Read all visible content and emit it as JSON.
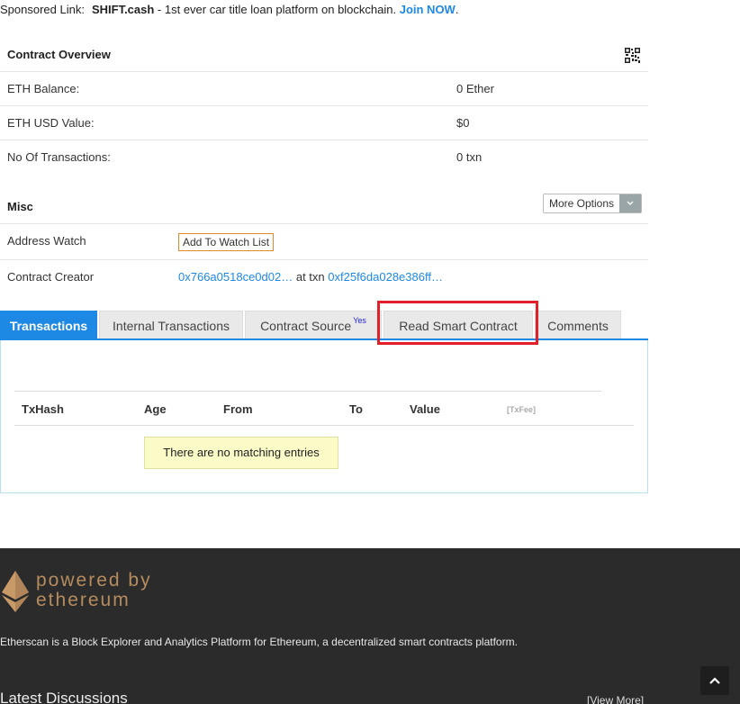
{
  "sponsored": {
    "label": "Sponsored Link:",
    "brand": "SHIFT.cash",
    "text": " - 1st ever car title loan platform on blockchain. ",
    "cta": "Join NOW",
    "end": "."
  },
  "overview": {
    "title": "Contract Overview",
    "rows": [
      {
        "label": "ETH Balance:",
        "value": "0 Ether"
      },
      {
        "label": "ETH USD Value:",
        "value": "$0"
      },
      {
        "label": "No Of Transactions:",
        "value": "0 txn"
      }
    ]
  },
  "misc": {
    "title": "Misc",
    "more_options": "More Options",
    "address_watch_label": "Address Watch",
    "watch_button": "Add To Watch List",
    "creator_label": "Contract Creator",
    "creator_address": "0x766a0518ce0d02…",
    "at_txn": " at txn ",
    "creator_txn": "0xf25f6da028e386ff…"
  },
  "tabs": [
    {
      "label": "Transactions",
      "active": true
    },
    {
      "label": "Internal Transactions"
    },
    {
      "label": "Contract Source",
      "sup": "Yes"
    },
    {
      "label": "Read Smart Contract"
    },
    {
      "label": "Comments"
    }
  ],
  "table": {
    "headers": [
      "TxHash",
      "Age",
      "From",
      "To",
      "Value",
      "[TxFee]"
    ],
    "empty_message": "There are no matching entries"
  },
  "footer": {
    "powered_line1": "powered by",
    "powered_line2": "ethereum",
    "description": "Etherscan is a Block Explorer and Analytics Platform for Ethereum, a decentralized smart contracts platform.",
    "latest_title": "Latest Discussions",
    "view_more": "[View More]"
  },
  "colors": {
    "accent": "#1e88e5",
    "highlight": "#e2202a",
    "footer_bg": "#2b2b2b"
  }
}
